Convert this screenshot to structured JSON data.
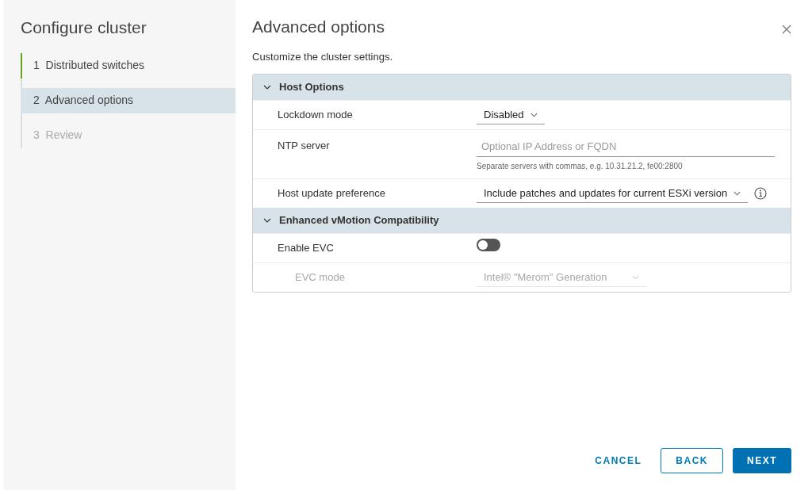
{
  "sidebar": {
    "title": "Configure cluster",
    "steps": [
      {
        "number": "1",
        "label": "Distributed switches",
        "selected": false,
        "completed": true,
        "disabled": false
      },
      {
        "number": "2",
        "label": "Advanced options",
        "selected": true,
        "completed": false,
        "disabled": false
      },
      {
        "number": "3",
        "label": "Review",
        "selected": false,
        "completed": false,
        "disabled": true
      }
    ]
  },
  "dialog": {
    "title": "Advanced options",
    "subtitle": "Customize the cluster settings.",
    "sections": [
      {
        "title": "Host Options",
        "expanded": true,
        "rows": [
          {
            "kind": "select",
            "label": "Lockdown mode",
            "value": "Disabled",
            "disabled": false
          },
          {
            "kind": "input",
            "label": "NTP server",
            "placeholder": "Optional IP Address or FQDN",
            "helper": "Separate servers with commas, e.g. 10.31.21.2, fe00:2800",
            "disabled": false
          },
          {
            "kind": "select-info",
            "label": "Host update preference",
            "value": "Include patches and updates for current ESXi version",
            "disabled": false
          }
        ]
      },
      {
        "title": "Enhanced vMotion Compatibility",
        "expanded": true,
        "rows": [
          {
            "kind": "toggle",
            "label": "Enable EVC",
            "on": false,
            "disabled": false
          },
          {
            "kind": "select",
            "label": "EVC mode",
            "value": "Intel® \"Merom\" Generation",
            "disabled": true,
            "indent": true
          }
        ]
      }
    ]
  },
  "buttons": [
    {
      "label": "CANCEL",
      "kind": "flat"
    },
    {
      "label": "BACK",
      "kind": "outline"
    },
    {
      "label": "NEXT",
      "kind": "primary"
    }
  ]
}
